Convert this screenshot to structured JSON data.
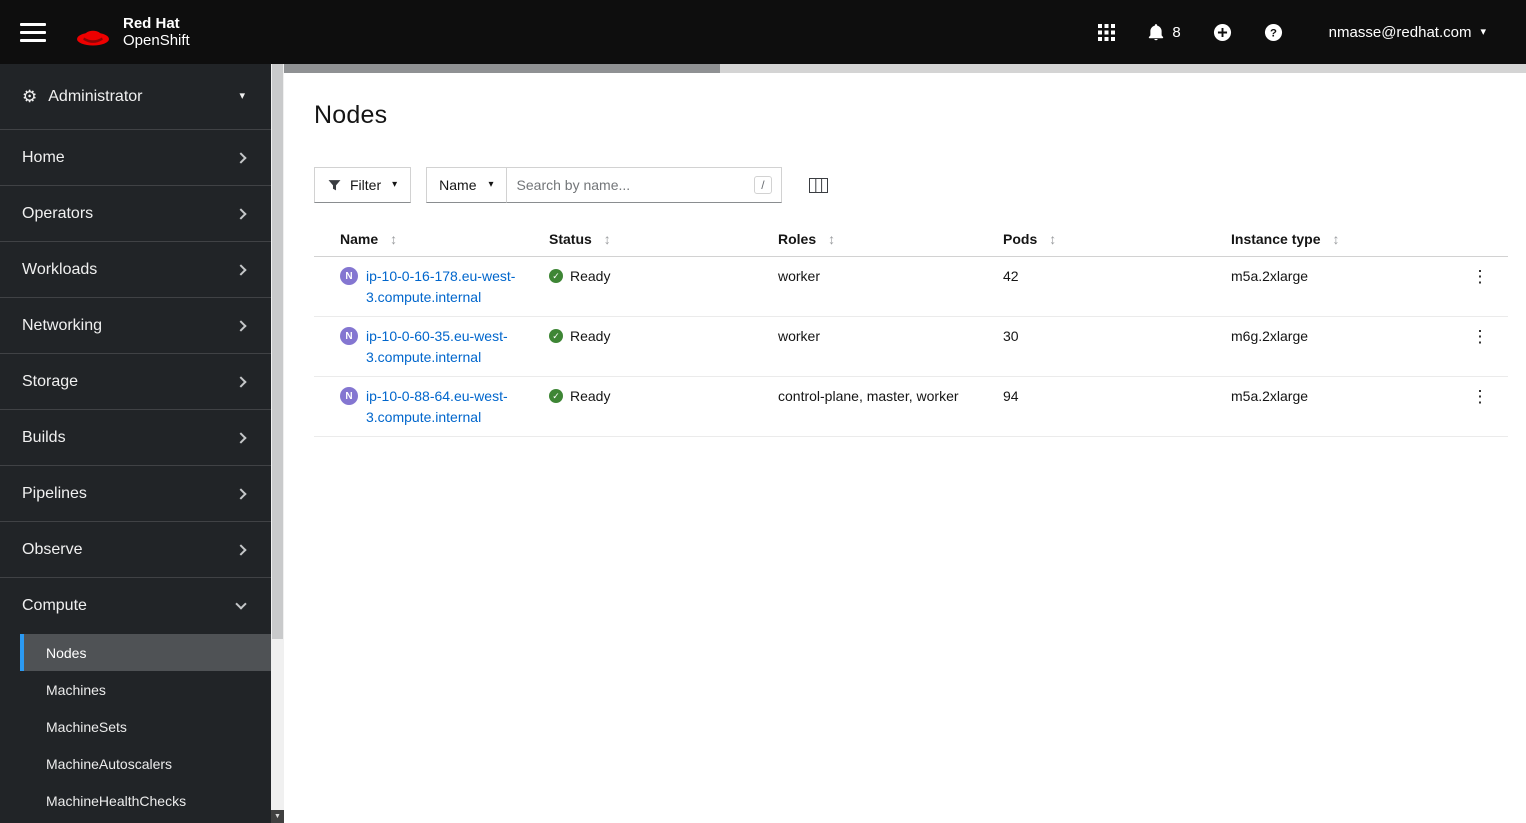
{
  "header": {
    "brand_line1": "Red Hat",
    "brand_line2": "OpenShift",
    "notification_count": "8",
    "user_menu": "nmasse@redhat.com"
  },
  "sidebar": {
    "perspective": "Administrator",
    "items": [
      {
        "label": "Home"
      },
      {
        "label": "Operators"
      },
      {
        "label": "Workloads"
      },
      {
        "label": "Networking"
      },
      {
        "label": "Storage"
      },
      {
        "label": "Builds"
      },
      {
        "label": "Pipelines"
      },
      {
        "label": "Observe"
      },
      {
        "label": "Compute",
        "expanded": true
      }
    ],
    "compute_children": [
      {
        "label": "Nodes",
        "active": true
      },
      {
        "label": "Machines"
      },
      {
        "label": "MachineSets"
      },
      {
        "label": "MachineAutoscalers"
      },
      {
        "label": "MachineHealthChecks"
      }
    ]
  },
  "page": {
    "title": "Nodes",
    "toolbar": {
      "filter_button": "Filter",
      "name_select": "Name",
      "search_placeholder": "Search by name...",
      "search_shortcut": "/",
      "search_value": ""
    },
    "table": {
      "columns": [
        "Name",
        "Status",
        "Roles",
        "Pods",
        "Instance type"
      ],
      "rows": [
        {
          "badge": "N",
          "name": "ip-10-0-16-178.eu-west-3.compute.internal",
          "status": "Ready",
          "roles": "worker",
          "pods": "42",
          "instance_type": "m5a.2xlarge"
        },
        {
          "badge": "N",
          "name": "ip-10-0-60-35.eu-west-3.compute.internal",
          "status": "Ready",
          "roles": "worker",
          "pods": "30",
          "instance_type": "m6g.2xlarge"
        },
        {
          "badge": "N",
          "name": "ip-10-0-88-64.eu-west-3.compute.internal",
          "status": "Ready",
          "roles": "control-plane, master, worker",
          "pods": "94",
          "instance_type": "m5a.2xlarge"
        }
      ]
    }
  },
  "icons": {
    "caret_down": "▾",
    "gear": "⚙",
    "sort": "↕",
    "kebab": "⋮",
    "check": "✓",
    "scroll_down": "▼"
  },
  "colors": {
    "brand_red": "#ee0000",
    "link_blue": "#0066cc",
    "status_ready_green": "#3e8635",
    "node_badge_purple": "#8476d1",
    "active_nav_blue": "#2b9af3"
  }
}
